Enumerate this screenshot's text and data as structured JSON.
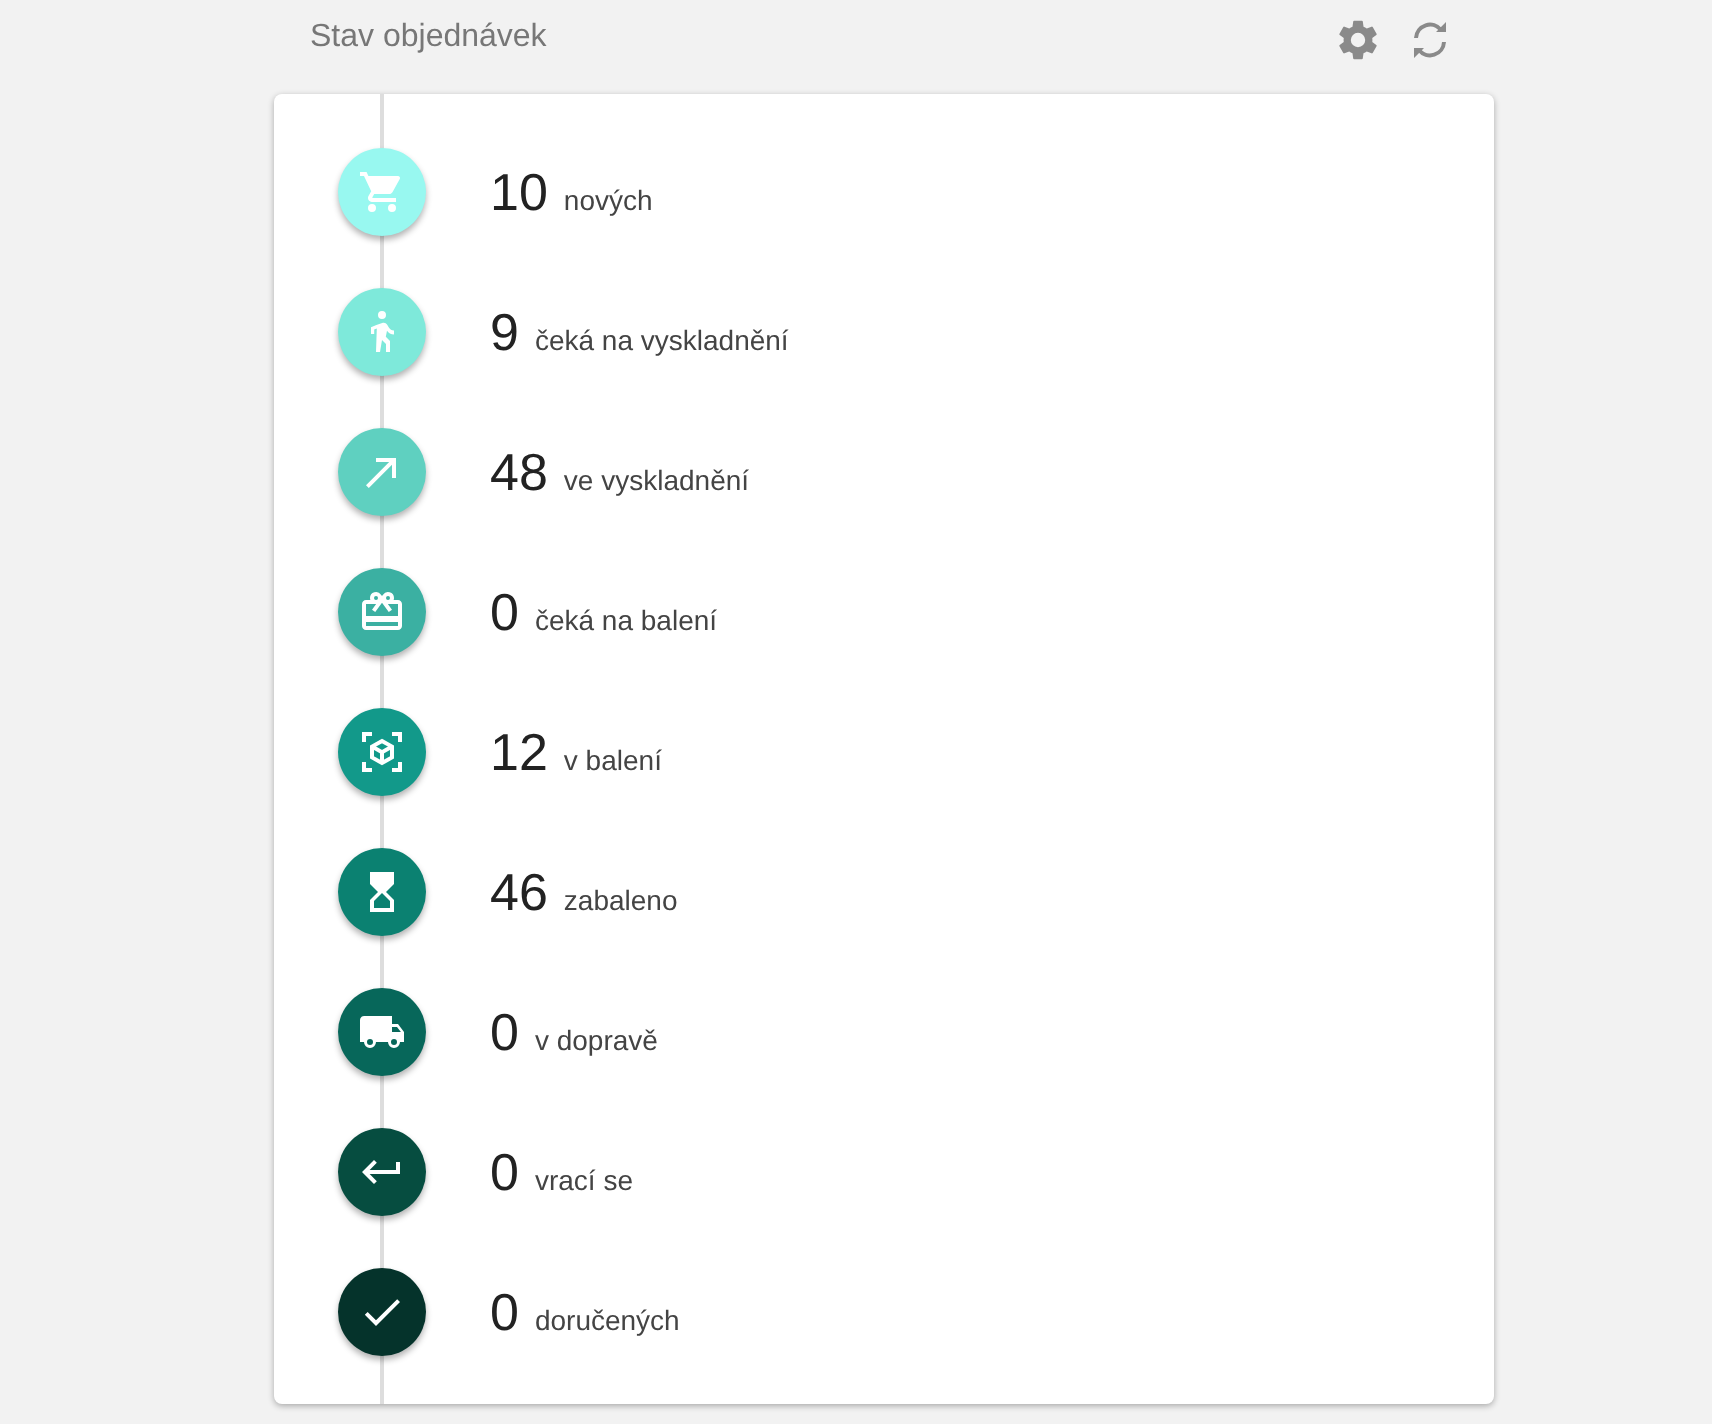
{
  "header": {
    "title": "Stav objednávek"
  },
  "statuses": [
    {
      "kind": "cart",
      "count": "10",
      "label": "nových",
      "color": "#98f8f0"
    },
    {
      "kind": "walk",
      "count": "9",
      "label": "čeká na vyskladnění",
      "color": "#7ee9da"
    },
    {
      "kind": "arrow",
      "count": "48",
      "label": "ve vyskladnění",
      "color": "#5fd0c0"
    },
    {
      "kind": "gift",
      "count": "0",
      "label": "čeká na balení",
      "color": "#3bb0a2"
    },
    {
      "kind": "box",
      "count": "12",
      "label": "v balení",
      "color": "#12998a"
    },
    {
      "kind": "hourglass",
      "count": "46",
      "label": "zabaleno",
      "color": "#0b8171"
    },
    {
      "kind": "truck",
      "count": "0",
      "label": "v dopravě",
      "color": "#07675a"
    },
    {
      "kind": "return",
      "count": "0",
      "label": "vrací se",
      "color": "#064d40"
    },
    {
      "kind": "check",
      "count": "0",
      "label": "doručených",
      "color": "#05332b"
    }
  ]
}
